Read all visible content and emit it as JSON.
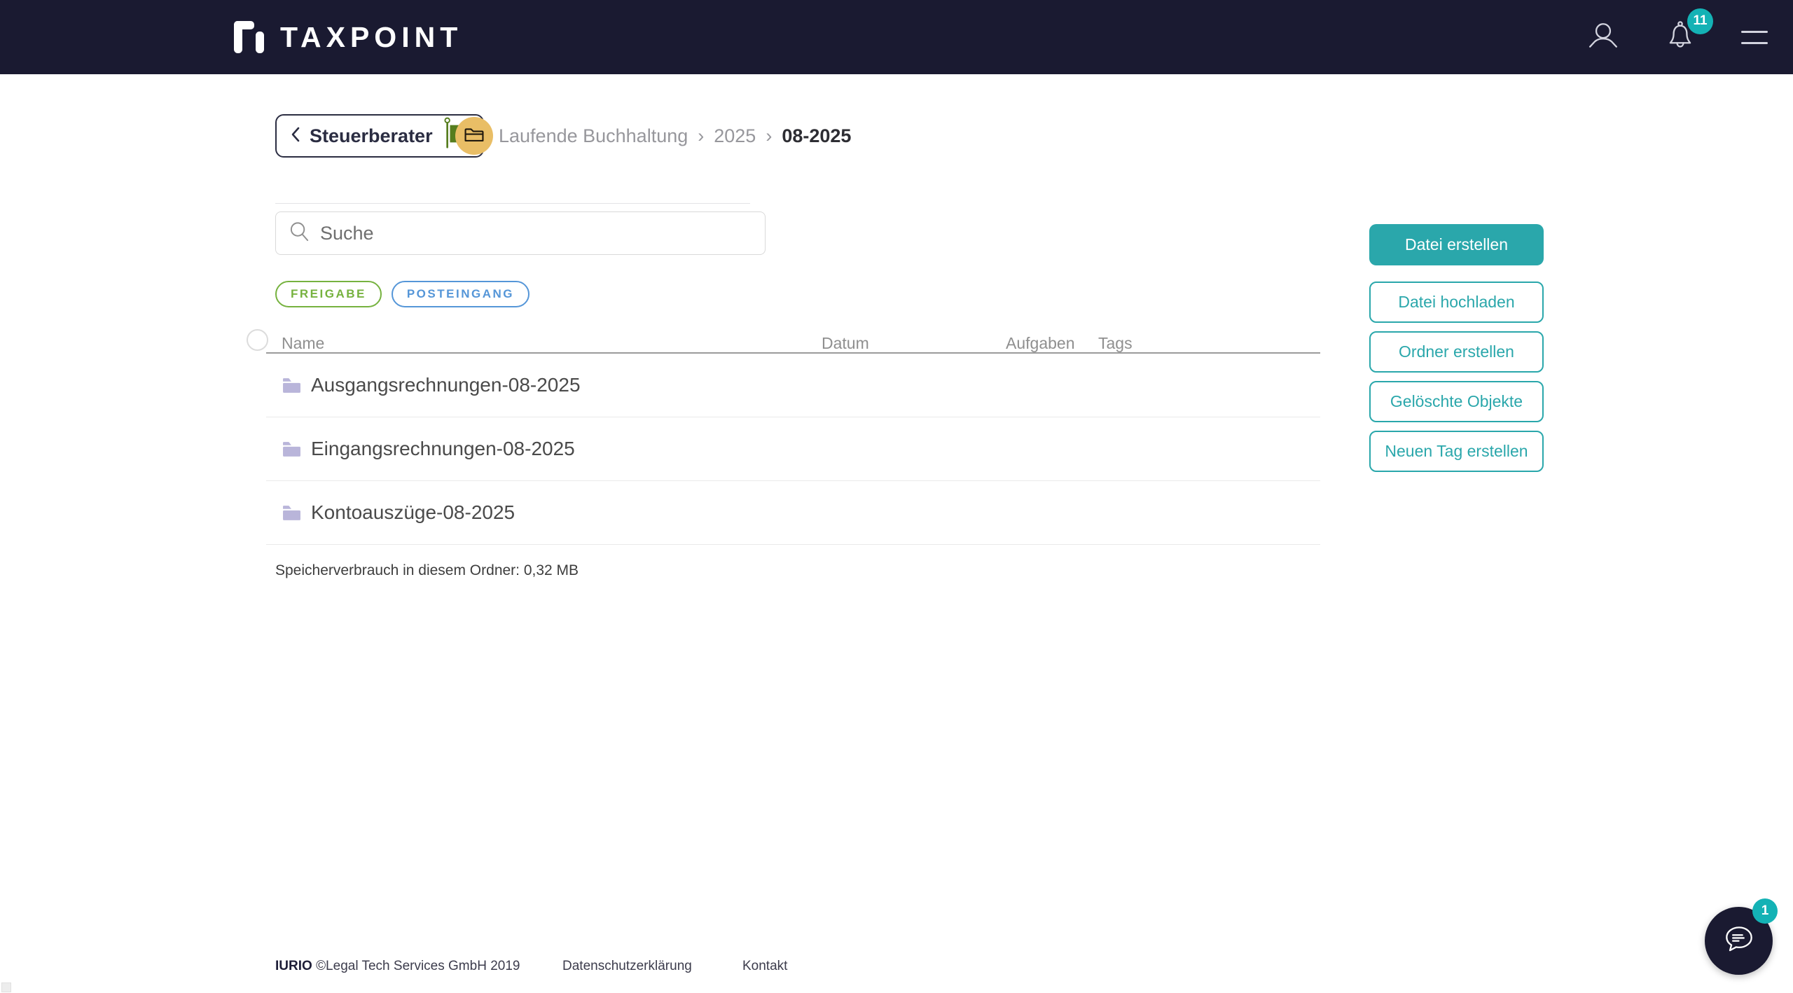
{
  "navbar": {
    "logo_text": "TAXPOINT",
    "notification_count": "11"
  },
  "breadcrumb": {
    "back_label": "Steuerberater",
    "separator": "›",
    "items": [
      {
        "label": "Laufende Buchhaltung",
        "current": false
      },
      {
        "label": "2025",
        "current": false
      },
      {
        "label": "08-2025",
        "current": true
      }
    ]
  },
  "search": {
    "placeholder": "Suche"
  },
  "filter_tags": [
    {
      "label": "FREIGABE",
      "color": "#76b23f"
    },
    {
      "label": "POSTEINGANG",
      "color": "#5596d8"
    }
  ],
  "table": {
    "columns": [
      "Name",
      "Datum",
      "Aufgaben",
      "Tags"
    ],
    "rows": [
      {
        "name": "Ausgangsrechnungen-08-2025",
        "type": "folder"
      },
      {
        "name": "Eingangsrechnungen-08-2025",
        "type": "folder"
      },
      {
        "name": "Kontoauszüge-08-2025",
        "type": "folder"
      }
    ]
  },
  "storage_note": "Speicherverbrauch in diesem Ordner: 0,32 MB",
  "actions": [
    {
      "label": "Datei erstellen",
      "variant": "filled"
    },
    {
      "label": "Datei hochladen",
      "variant": "outline"
    },
    {
      "label": "Ordner erstellen",
      "variant": "outline"
    },
    {
      "label": "Gelöschte Objekte",
      "variant": "outline"
    },
    {
      "label": "Neuen Tag erstellen",
      "variant": "outline"
    }
  ],
  "footer": {
    "brand": "IURIO",
    "copyright": "©Legal Tech Services GmbH 2019",
    "links": [
      {
        "label": "Datenschutzerklärung"
      },
      {
        "label": "Kontakt"
      }
    ]
  },
  "chat": {
    "unread_count": "1"
  },
  "colors": {
    "navbar_bg": "#1a1a31",
    "accent_teal": "#2aa7ab",
    "badge_teal": "#14b2b5",
    "tag_green": "#76b23f",
    "tag_blue": "#5596d8",
    "folder_badge_amber": "#e9be66",
    "row_folder_lavender": "#b9b5da",
    "flag_green": "#567d1e"
  }
}
